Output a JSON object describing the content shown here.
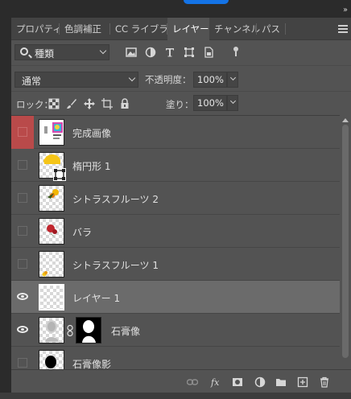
{
  "tabs": [
    {
      "label": "プロパティ",
      "active": false
    },
    {
      "label": "色調補正",
      "active": false
    },
    {
      "label": "CC ライブラリ",
      "active": false
    },
    {
      "label": "レイヤー",
      "active": true
    },
    {
      "label": "チャンネル",
      "active": false
    },
    {
      "label": "パス",
      "active": false
    }
  ],
  "filter": {
    "kind_value": "種類"
  },
  "blend": {
    "mode_value": "通常",
    "opacity_label": "不透明度：",
    "opacity_value": "100%"
  },
  "lock": {
    "label": "ロック：",
    "fill_label": "塗り：",
    "fill_value": "100%"
  },
  "layers": [
    {
      "name": "完成画像",
      "visible": false,
      "selected": false,
      "highlight": true,
      "thumb": "composite"
    },
    {
      "name": "楕円形 1",
      "visible": false,
      "selected": false,
      "highlight": false,
      "thumb": "ellipse"
    },
    {
      "name": "シトラスフルーツ 2",
      "visible": false,
      "selected": false,
      "highlight": false,
      "thumb": "citrus2"
    },
    {
      "name": "バラ",
      "visible": false,
      "selected": false,
      "highlight": false,
      "thumb": "rose"
    },
    {
      "name": "シトラスフルーツ 1",
      "visible": false,
      "selected": false,
      "highlight": false,
      "thumb": "citrus1"
    },
    {
      "name": "レイヤー 1",
      "visible": true,
      "selected": true,
      "highlight": false,
      "thumb": "blank"
    },
    {
      "name": "石膏像",
      "visible": true,
      "selected": false,
      "highlight": false,
      "thumb": "statue",
      "mask": true
    },
    {
      "name": "石膏像影",
      "visible": false,
      "selected": false,
      "highlight": false,
      "thumb": "shadow"
    }
  ],
  "colors": {
    "panel": "#535353",
    "tabbar": "#434343",
    "selected_row": "#6b6b6b",
    "highlight_red": "#b94a4a",
    "accent_blue": "#1473e6"
  },
  "icons": {
    "filter": [
      "image-filter-icon",
      "adjustment-filter-icon",
      "type-filter-icon",
      "shape-filter-icon",
      "smart-object-filter-icon"
    ],
    "lock": [
      "lock-transparent-pixels-icon",
      "lock-image-pixels-icon",
      "lock-position-icon",
      "lock-artboard-icon",
      "lock-all-icon"
    ],
    "footer": [
      "link-layers-icon",
      "layer-style-fx-icon",
      "add-mask-icon",
      "adjustment-layer-icon",
      "new-group-icon",
      "new-layer-icon",
      "delete-layer-icon"
    ]
  }
}
